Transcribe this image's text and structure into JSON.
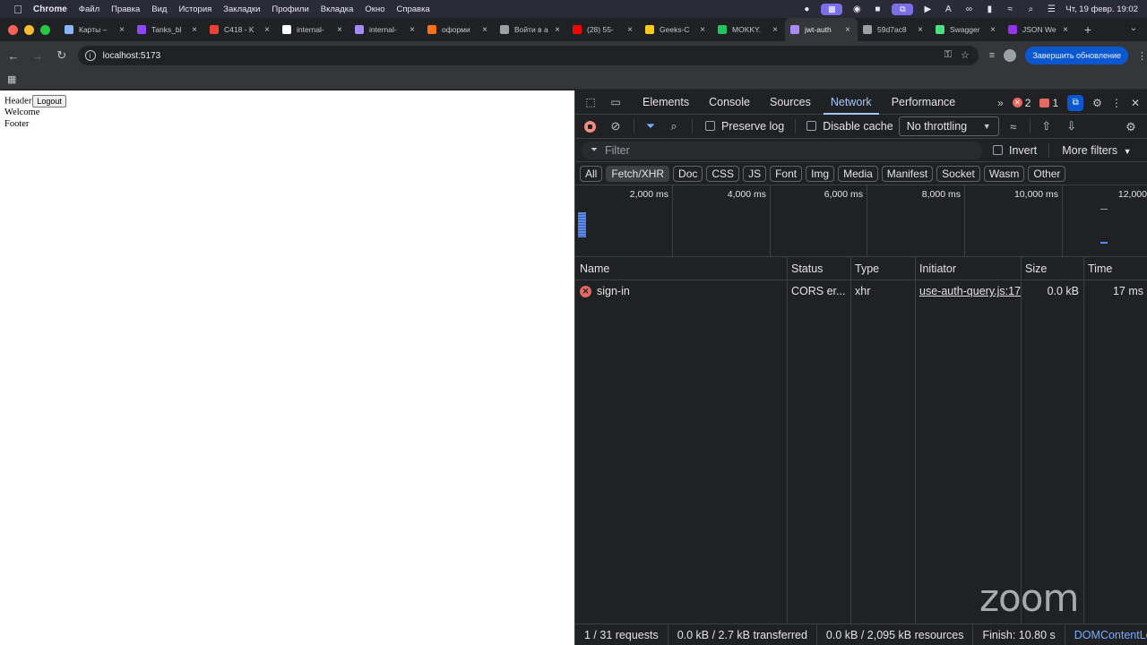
{
  "menubar": {
    "items": [
      "Chrome",
      "Файл",
      "Правка",
      "Вид",
      "История",
      "Закладки",
      "Профили",
      "Вкладка",
      "Окно",
      "Справка"
    ],
    "clock": "Чт, 19 февр.  19:02"
  },
  "tabs": [
    {
      "label": "Карты –",
      "color": "#8ab4f8"
    },
    {
      "label": "Tanks_bl",
      "color": "#9146ff"
    },
    {
      "label": "C418 - K",
      "color": "#ea4335"
    },
    {
      "label": "internal-",
      "color": "#ffffff"
    },
    {
      "label": "internal-",
      "color": "#a78bfa"
    },
    {
      "label": "оформи",
      "color": "#f97316"
    },
    {
      "label": "Войти в а",
      "color": "#9aa0a6"
    },
    {
      "label": "(28) 55-",
      "color": "#ff0000"
    },
    {
      "label": "Geeks-C",
      "color": "#facc15"
    },
    {
      "label": "MOKKY.",
      "color": "#22c55e"
    },
    {
      "label": "jwt-auth",
      "color": "#a78bfa"
    },
    {
      "label": "59d7ac8",
      "color": "#9aa0a6"
    },
    {
      "label": "Swagger",
      "color": "#4ade80"
    },
    {
      "label": "JSON We",
      "color": "#9333ea"
    }
  ],
  "toolbar": {
    "url": "localhost:5173",
    "update_label": "Завершить обновление"
  },
  "page": {
    "header": "Header",
    "logout": "Logout",
    "welcome": "Welcome",
    "footer": "Footer"
  },
  "devtools": {
    "tabs": [
      "Elements",
      "Console",
      "Sources",
      "Network",
      "Performance"
    ],
    "errors_count": "2",
    "messages_count": "1",
    "preserve_log": "Preserve log",
    "disable_cache": "Disable cache",
    "throttling": "No throttling",
    "filter_placeholder": "Filter",
    "invert": "Invert",
    "more_filters": "More filters",
    "types": [
      "All",
      "Fetch/XHR",
      "Doc",
      "CSS",
      "JS",
      "Font",
      "Img",
      "Media",
      "Manifest",
      "Socket",
      "Wasm",
      "Other"
    ],
    "overview_ticks": [
      "2,000 ms",
      "4,000 ms",
      "6,000 ms",
      "8,000 ms",
      "10,000 ms",
      "12,000"
    ],
    "columns": [
      "Name",
      "Status",
      "Type",
      "Initiator",
      "Size",
      "Time"
    ],
    "requests": [
      {
        "name": "sign-in",
        "status": "CORS er...",
        "type": "xhr",
        "initiator": "use-auth-query.js:17",
        "size": "0.0 kB",
        "time": "17 ms"
      }
    ],
    "status": {
      "requests": "1 / 31 requests",
      "transferred": "0.0 kB / 2.7 kB transferred",
      "resources": "0.0 kB / 2,095 kB resources",
      "finish": "Finish: 10.80 s",
      "dcl": "DOMContentLo"
    }
  },
  "overlay": {
    "zoom": "zoom"
  }
}
